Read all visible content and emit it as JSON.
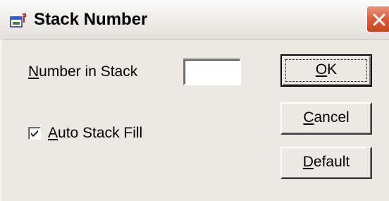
{
  "window": {
    "title": "Stack Number",
    "close_icon": "close-icon",
    "app_icon": "dialog-app-icon"
  },
  "form": {
    "number_label_mnemonic": "N",
    "number_label_rest": "umber in Stack",
    "number_value": "",
    "auto_fill_checked": true,
    "auto_fill_mnemonic": "A",
    "auto_fill_rest": "uto Stack Fill"
  },
  "buttons": {
    "ok_mnemonic": "O",
    "ok_rest": "K",
    "cancel_mnemonic": "C",
    "cancel_rest": "ancel",
    "default_mnemonic": "D",
    "default_rest": "efault"
  },
  "colors": {
    "dialog_bg": "#ece9e4",
    "close_button": "#d65d3c"
  }
}
